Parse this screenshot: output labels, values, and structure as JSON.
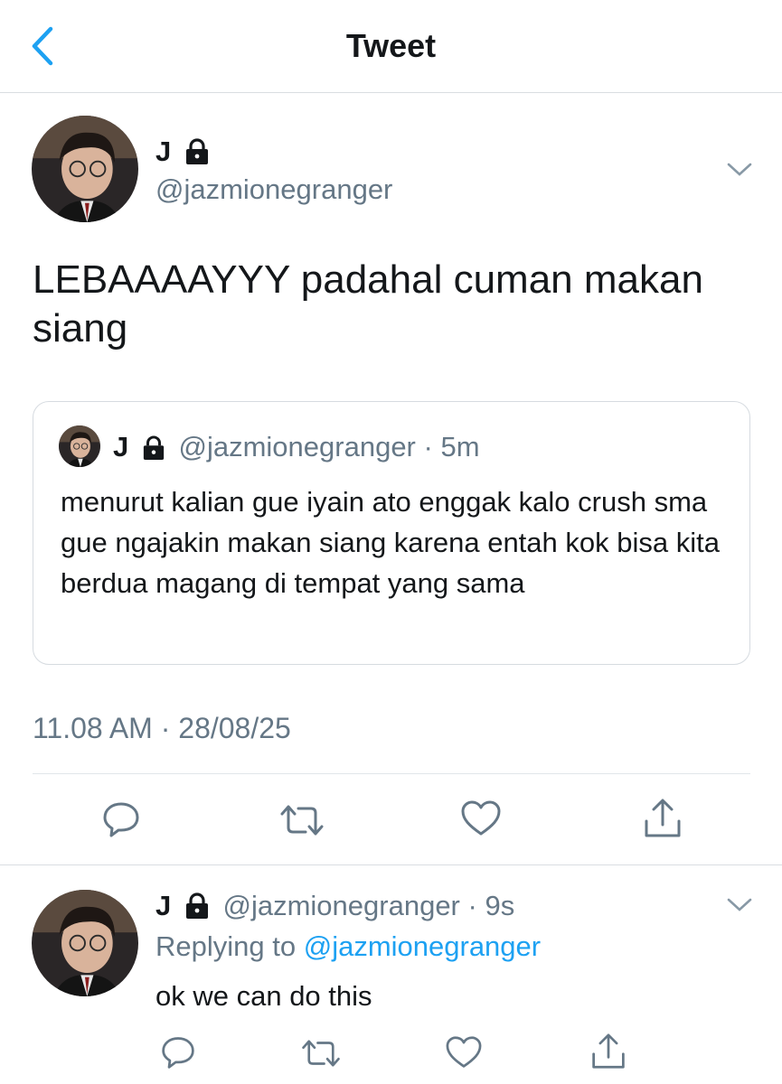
{
  "header": {
    "title": "Tweet"
  },
  "main_tweet": {
    "name": "J",
    "handle": "@jazmionegranger",
    "text": "LEBAAAAYYY padahal cuman makan siang",
    "timestamp": "11.08 AM · 28/08/25"
  },
  "quoted_tweet": {
    "name": "J",
    "handle": "@jazmionegranger",
    "time": "· 5m",
    "text": "menurut kalian gue iyain ato enggak kalo crush sma gue ngajakin makan siang karena entah kok bisa kita berdua magang di tempat yang sama"
  },
  "reply_tweet": {
    "name": "J",
    "handle": "@jazmionegranger",
    "time": "· 9s",
    "replying_prefix": "Replying to",
    "replying_to": "@jazmionegranger",
    "text": "ok we can do this"
  },
  "icons": {
    "back": "chevron-left-icon",
    "lock": "lock-icon",
    "more": "chevron-down-icon",
    "reply": "comment-icon",
    "retweet": "retweet-icon",
    "like": "heart-icon",
    "share": "share-icon"
  },
  "colors": {
    "accent": "#1da1f2",
    "secondary_text": "#657786",
    "action_icon": "#657786"
  }
}
